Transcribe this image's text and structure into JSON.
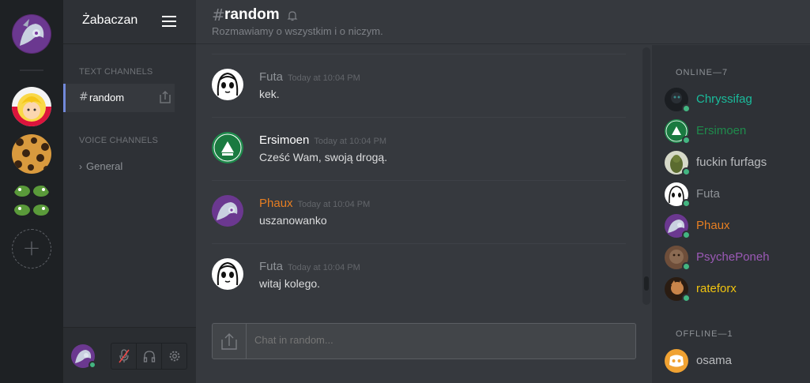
{
  "guild": {
    "name": "Żabaczan"
  },
  "servers": [
    {
      "name": "server-phaux",
      "active": true
    },
    {
      "name": "server-blonde-girl"
    },
    {
      "name": "server-leopard"
    },
    {
      "name": "server-frogs"
    }
  ],
  "sidebar": {
    "text_category": "TEXT CHANNELS",
    "voice_category": "VOICE CHANNELS",
    "active_channel": {
      "hash": "#",
      "name": "random"
    },
    "voice_channel": {
      "chevron": "›",
      "name": "General"
    }
  },
  "header": {
    "hash": "#",
    "channel_name": "random",
    "topic": "Rozmawiamy o wszystkim i o niczym."
  },
  "messages": [
    {
      "user": "Futa",
      "user_color": "#8e9297",
      "time": "Today at 10:04 PM",
      "text": "kek."
    },
    {
      "user": "Ersimoen",
      "user_color": "#ffffff",
      "time": "Today at 10:04 PM",
      "text": "Cześć Wam, swoją drogą."
    },
    {
      "user": "Phaux",
      "user_color": "#e67e22",
      "time": "Today at 10:04 PM",
      "text": "uszanowanko"
    },
    {
      "user": "Futa",
      "user_color": "#8e9297",
      "time": "Today at 10:04 PM",
      "text": "witaj kolego."
    }
  ],
  "input": {
    "placeholder": "Chat in random..."
  },
  "members": {
    "online_label": "ONLINE—7",
    "offline_label": "OFFLINE—1",
    "online": [
      {
        "name": "Chryssifag",
        "color": "#1abc9c"
      },
      {
        "name": "Ersimoen",
        "color": "#1f8b4c"
      },
      {
        "name": "fuckin furfags",
        "color": "#b9bbbe"
      },
      {
        "name": "Futa",
        "color": "#8e9297"
      },
      {
        "name": "Phaux",
        "color": "#e67e22"
      },
      {
        "name": "PsychePoneh",
        "color": "#9b59b6"
      },
      {
        "name": "rateforx",
        "color": "#f1c40f"
      }
    ],
    "offline": [
      {
        "name": "osama",
        "color": "#b9bbbe"
      }
    ]
  },
  "colors": {
    "accent": "#7289da",
    "online": "#43b581"
  }
}
